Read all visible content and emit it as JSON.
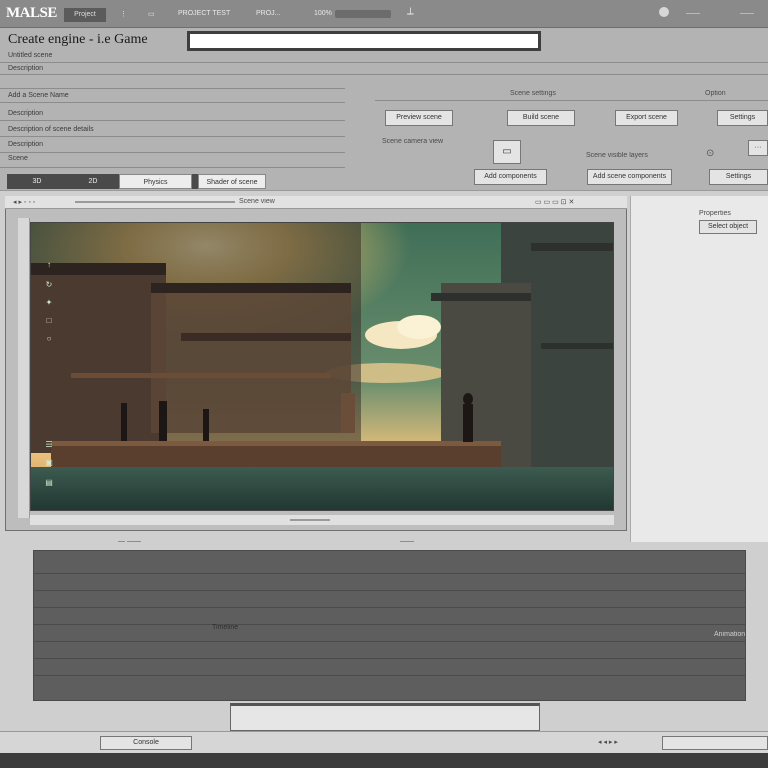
{
  "app": {
    "logo": "MALSE",
    "tab": "Project",
    "menu": [
      "PROJECT TEST",
      "PROJ..."
    ],
    "zoom_label": "100%"
  },
  "header": {
    "title": "Create engine - i.e Game",
    "field_value": "",
    "form_labels": [
      "Untitled scene",
      "Description",
      "Add a Scene Name",
      "Description",
      "Description of scene details",
      "Description",
      "Scene"
    ],
    "mode_toggle": [
      "3D",
      "2D",
      "Physics",
      "Shader of scene"
    ]
  },
  "actions": {
    "row1": [
      "Preview scene",
      "Build scene",
      "Export scene",
      "Settings"
    ],
    "row1_headers": [
      "Scene settings",
      "Option"
    ],
    "row2": [
      "Add components",
      "Add scene components",
      "Settings"
    ],
    "side_labels": [
      "Scene camera view",
      "Scene visible layers"
    ]
  },
  "editor": {
    "toolbar_text": "Scene view",
    "tools": [
      "↑",
      "↻",
      "✦",
      "□",
      "○",
      "☰"
    ]
  },
  "right_panel": {
    "title": "Properties",
    "field": "Select object"
  },
  "timeline": {
    "label_left": "Timeline",
    "label_right": "Animation"
  },
  "footer": {
    "left": "Console"
  },
  "colors": {
    "accent": "#4a4a4a",
    "scene_sky": "#3f7a57",
    "scene_sun": "#f2c66a"
  }
}
